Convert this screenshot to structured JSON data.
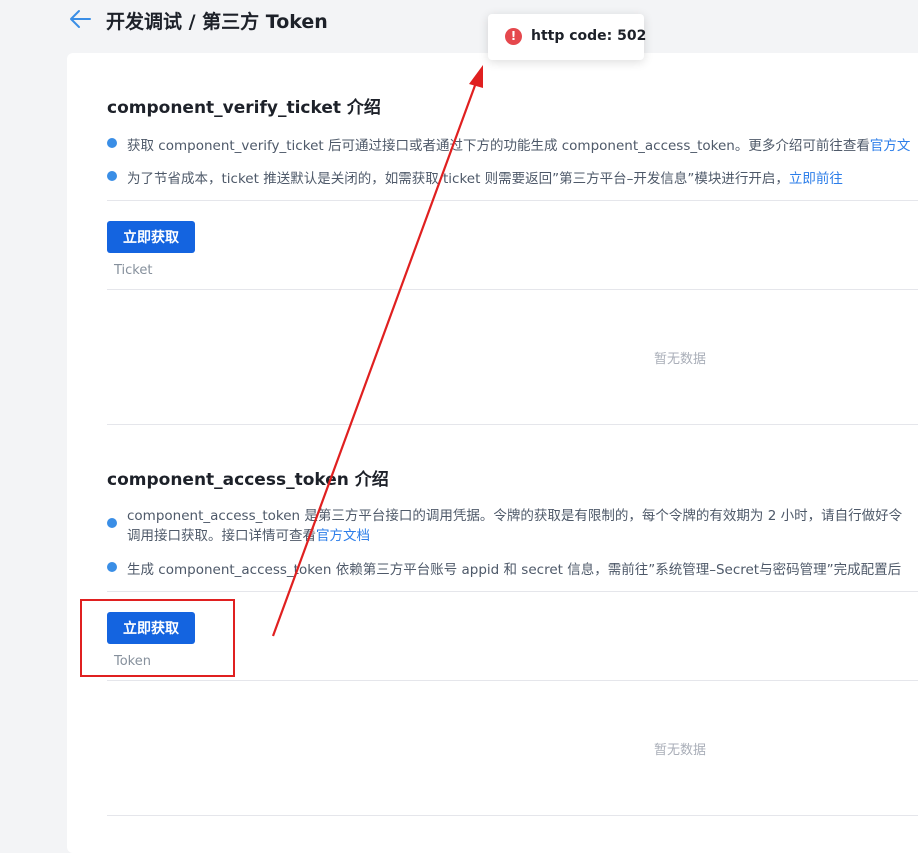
{
  "header": {
    "title": "开发调试 / 第三方 Token",
    "back_icon": "arrow-left-icon"
  },
  "toast": {
    "icon": "error-circle-icon",
    "message": "http code: 502"
  },
  "section_ticket": {
    "title": "component_verify_ticket 介绍",
    "bullets": [
      {
        "text": "获取 component_verify_ticket 后可通过接口或者通过下方的功能生成 component_access_token。更多介绍可前往查看",
        "link": "官方文"
      },
      {
        "text": "为了节省成本，ticket 推送默认是关闭的，如需获取 ticket 则需要返回”第三方平台–开发信息”模块进行开启，",
        "link": "立即前往"
      }
    ],
    "button_label": "立即获取",
    "column_label": "Ticket",
    "empty_text": "暂无数据"
  },
  "section_token": {
    "title": "component_access_token 介绍",
    "bullets": [
      {
        "line1": "component_access_token 是第三方平台接口的调用凭据。令牌的获取是有限制的，每个令牌的有效期为 2 小时，请自行做好令",
        "line2": "调用接口获取。接口详情可查看",
        "link": "官方文档"
      },
      {
        "text": "生成 component_access_token 依赖第三方平台账号 appid 和 secret 信息，需前往”系统管理–Secret与密码管理”完成配置后"
      }
    ],
    "button_label": "立即获取",
    "column_label": "Token",
    "empty_text": "暂无数据"
  },
  "colors": {
    "primary": "#1464e0",
    "link": "#2b7de9",
    "bullet": "#3a8ee6",
    "error": "#e5484d",
    "annotation": "#e02020"
  }
}
